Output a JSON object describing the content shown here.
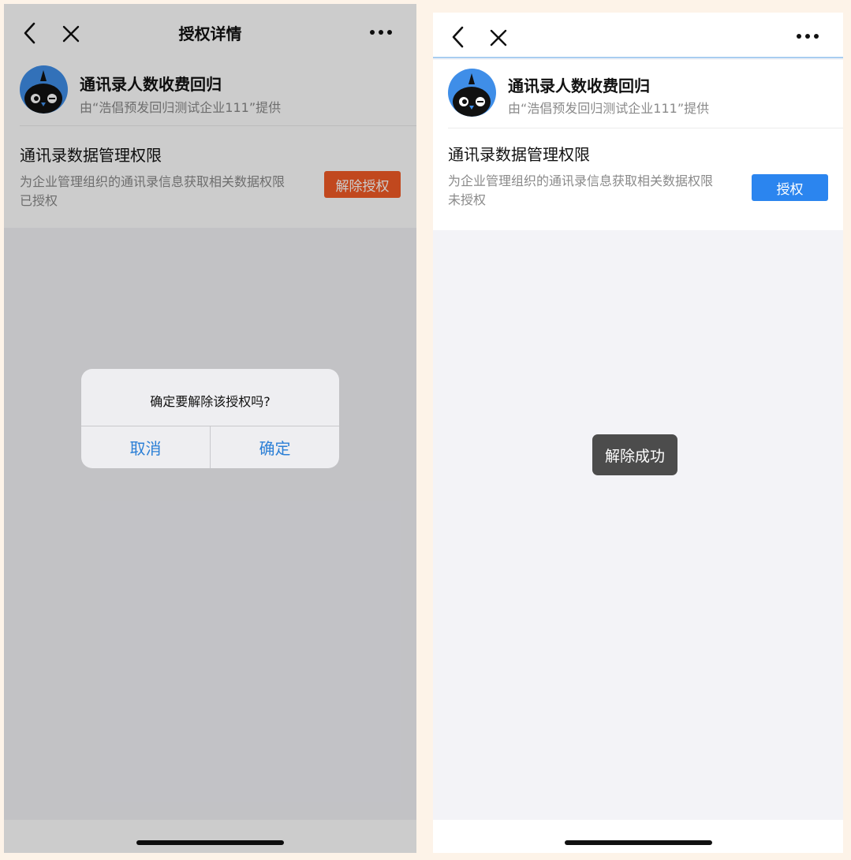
{
  "left": {
    "nav": {
      "title": "授权详情"
    },
    "app": {
      "name": "通讯录人数收费回归",
      "provider": "由“浩倡预发回归测试企业111”提供"
    },
    "permission": {
      "title": "通讯录数据管理权限",
      "description": "为企业管理组织的通讯录信息获取相关数据权限",
      "status": "已授权",
      "action_label": "解除授权"
    },
    "dialog": {
      "message": "确定要解除该授权吗?",
      "cancel_label": "取消",
      "confirm_label": "确定"
    }
  },
  "right": {
    "app": {
      "name": "通讯录人数收费回归",
      "provider": "由“浩倡预发回归测试企业111”提供"
    },
    "permission": {
      "title": "通讯录数据管理权限",
      "description": "为企业管理组织的通讯录信息获取相关数据权限",
      "status": "未授权",
      "action_label": "授权"
    },
    "toast": {
      "message": "解除成功"
    }
  },
  "colors": {
    "revoke_button": "#f25a26",
    "grant_button": "#2b85ef",
    "dialog_button_text": "#2b7fd6",
    "toast_bg": "#4c4c4c",
    "avatar_bg": "#3f8ee8",
    "page_bg": "#fdf3e8"
  },
  "icons": {
    "back": "chevron-left-icon",
    "close": "close-icon",
    "more": "more-dots-icon",
    "avatar": "bird-avatar-icon"
  }
}
